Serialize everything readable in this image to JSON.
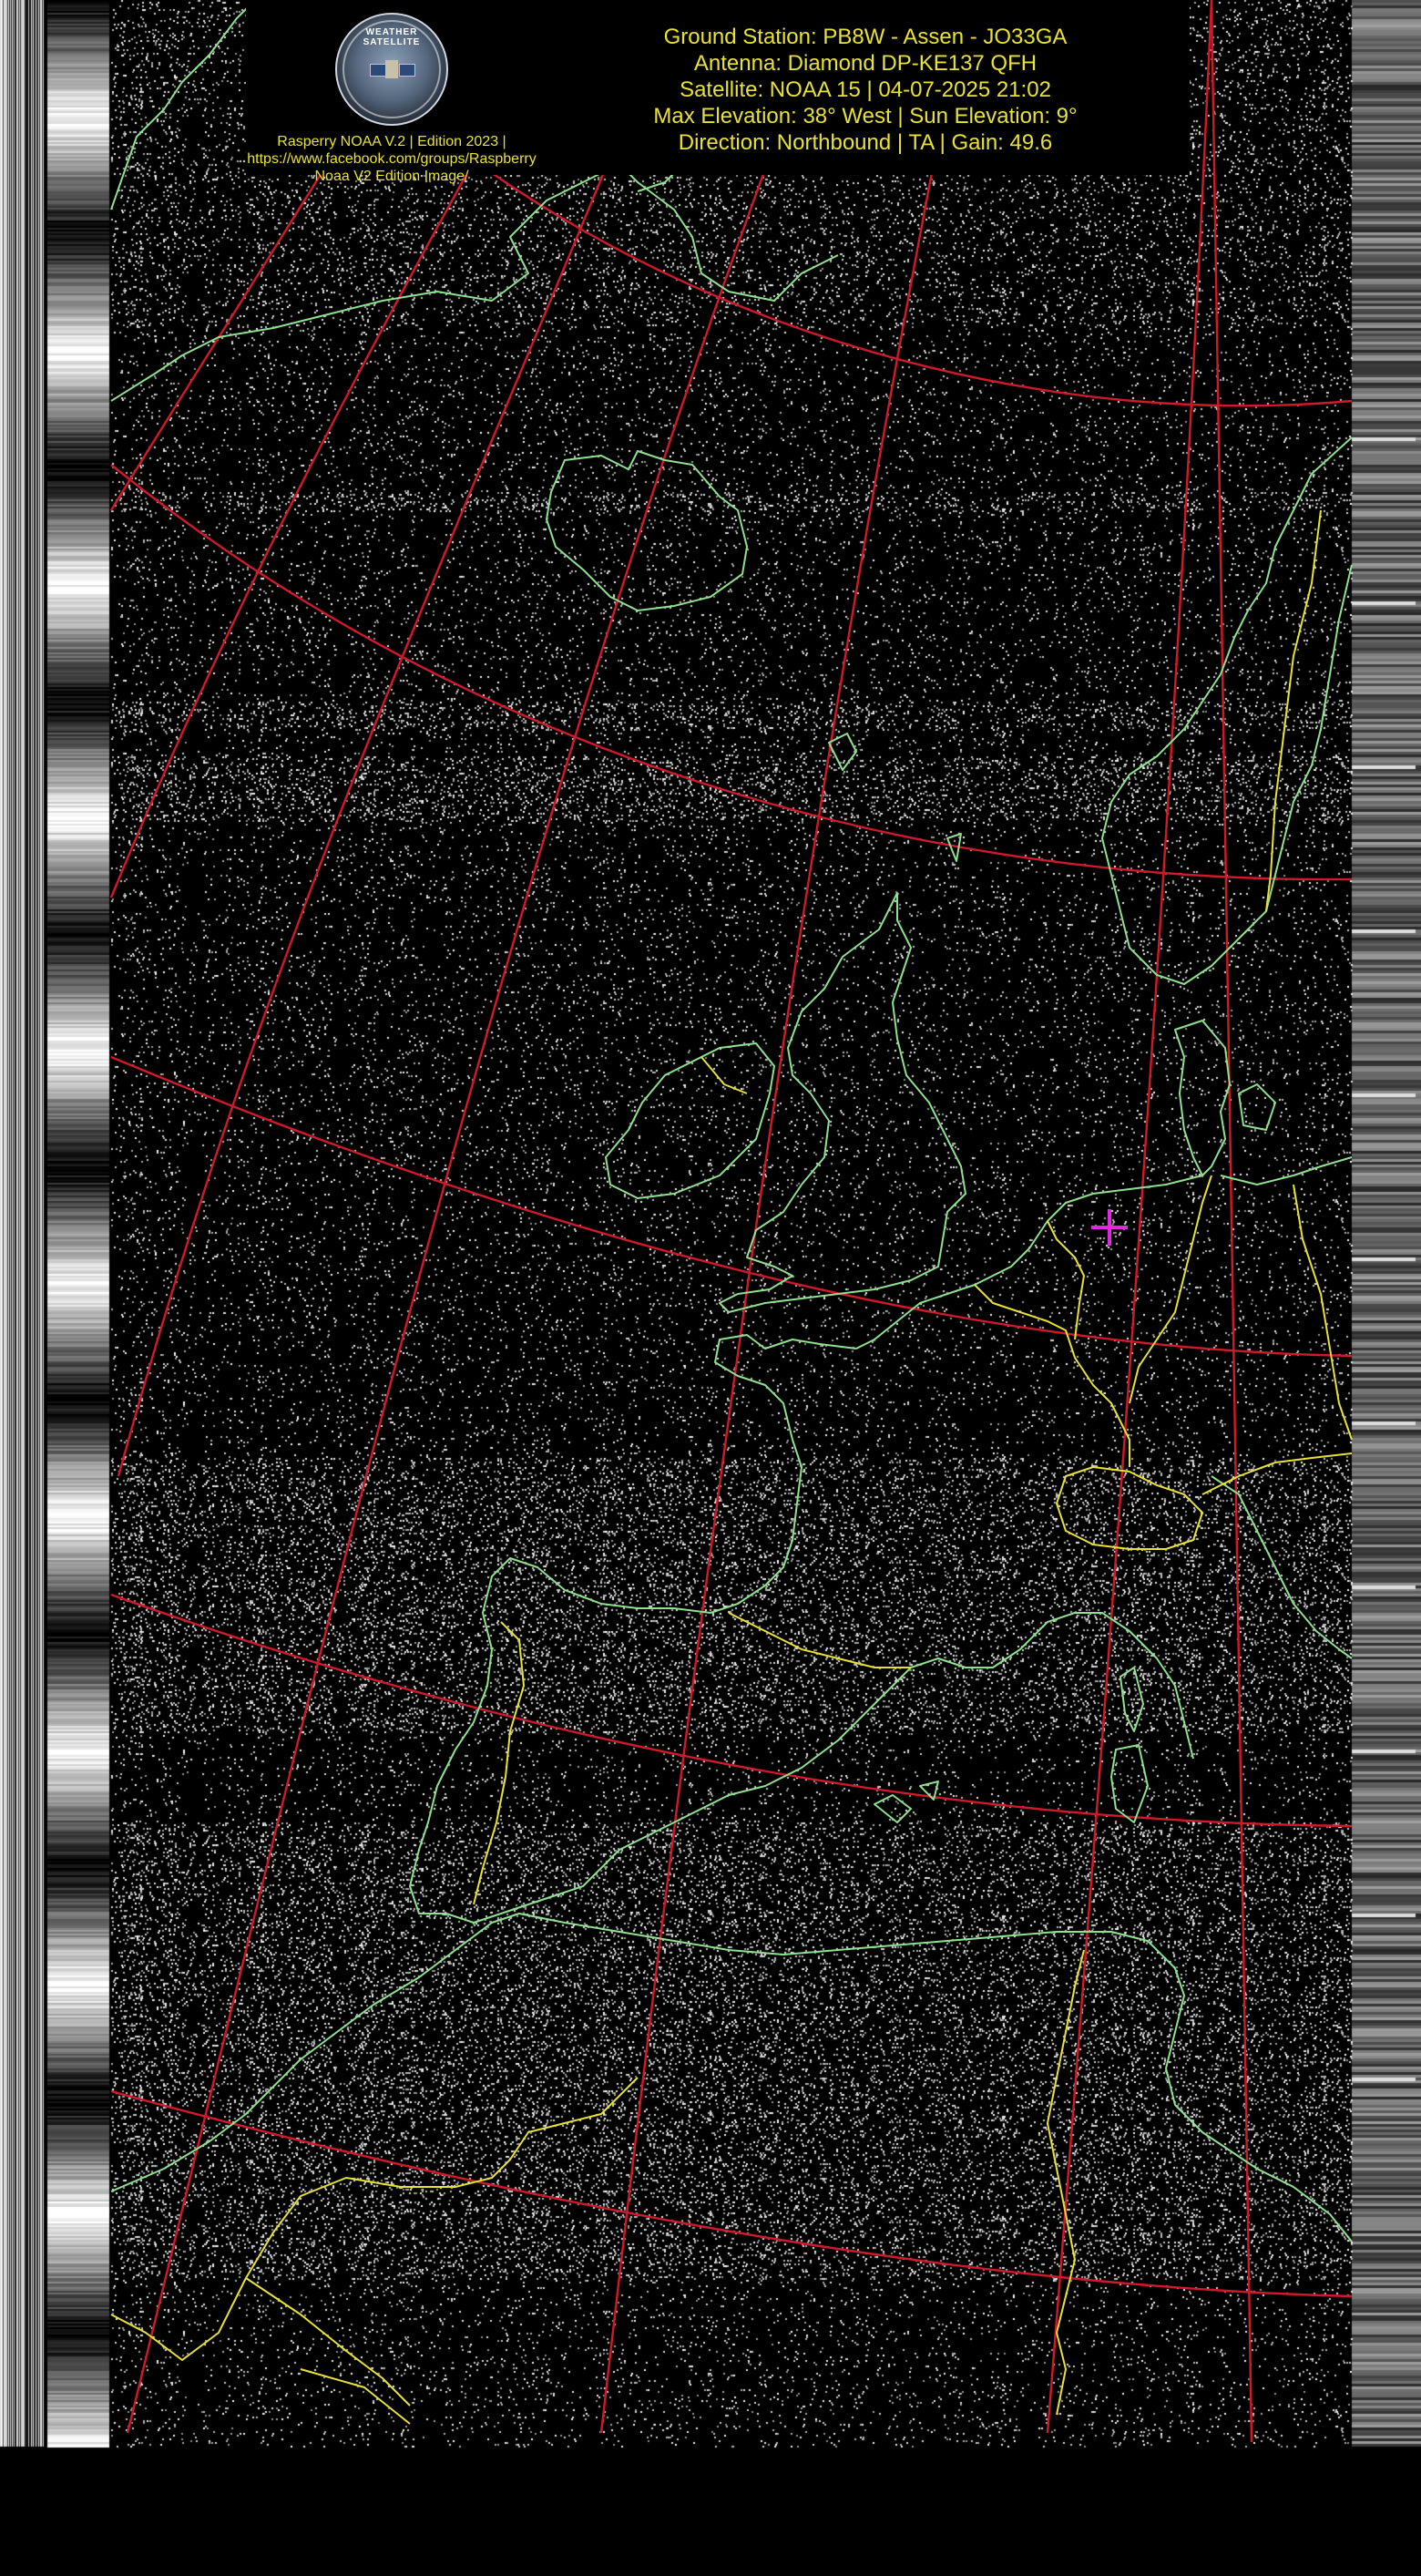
{
  "header": {
    "logo": {
      "icon": "weather-satellite-logo-icon",
      "arc_text": "WEATHER SATELLITE"
    },
    "credit_lines": [
      "Rasperry NOAA V.2 | Edition 2023 |",
      "https://www.facebook.com/groups/Raspberry",
      "Noaa V2 Edition Image/"
    ],
    "info_lines": [
      "Ground Station: PB8W - Assen - JO33GA",
      "Antenna: Diamond DP-KE137 QFH",
      "Satellite: NOAA 15 | 04-07-2025 21:02",
      "Max Elevation: 38° West | Sun Elevation: 9°",
      "Direction: Northbound | TA | Gain: 49.6"
    ]
  },
  "map": {
    "type": "NOAA APT satellite image with map overlay",
    "colors": {
      "background": "#000000",
      "noise": "#ffffff",
      "coastline": "#8fe08f",
      "border": "#e8e234",
      "graticule": "#d0192a",
      "station_marker": "#e028e0",
      "header_text": "#e8e234"
    },
    "station_marker": {
      "icon": "crosshair-plus-icon",
      "location": "Assen, Netherlands"
    }
  }
}
